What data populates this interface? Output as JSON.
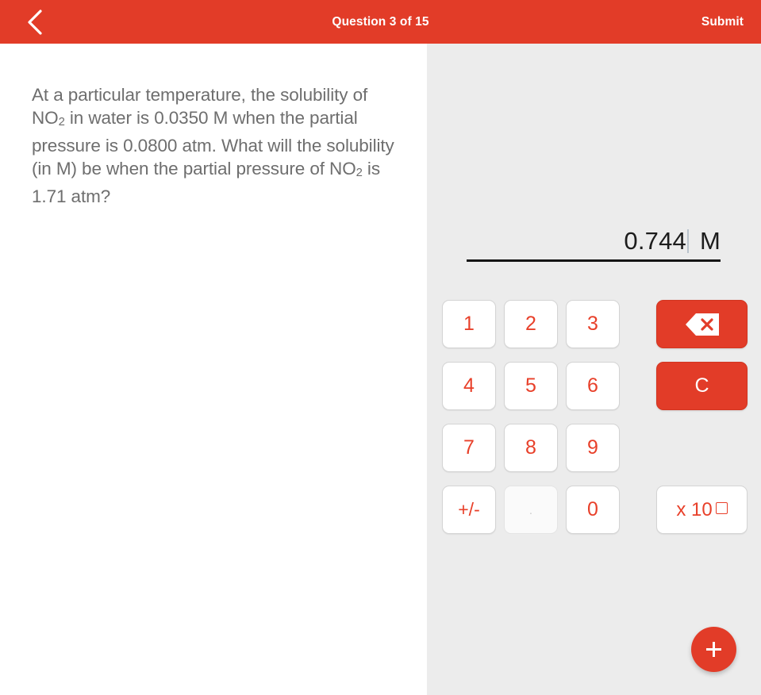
{
  "header": {
    "back_icon": "chevron-left-icon",
    "title": "Question 3 of 15",
    "submit_label": "Submit",
    "background_color": "#e23c28",
    "text_color": "#ffffff"
  },
  "question": {
    "text_parts": [
      "At a particular temperature, the solubility of NO",
      "2",
      " in water is 0.0350 M when the partial pressure is 0.0800 atm. What will the solubility (in M) be when the partial pressure of NO",
      "2",
      " is 1.71 atm?"
    ],
    "line1": "At a particular temperature, the solubility",
    "line2_a": "of NO",
    "line2_sub": "2",
    "line2_b": " in water is 0.0350 M when the",
    "line3": "partial pressure is 0.0800 atm. What will",
    "line4": "the solubility (in M) be when the partial",
    "line5_a": "pressure of NO",
    "line5_sub": "2",
    "line5_b": " is 1.71 atm?",
    "text_color": "#6e6e6e"
  },
  "answer": {
    "value": "0.744",
    "unit": "M",
    "caret_visible": true,
    "text_color": "#1c1c1c",
    "underline_color": "#151515"
  },
  "keypad": {
    "accent_color": "#e8402a",
    "keys": [
      {
        "label": "1",
        "name": "key-1",
        "enabled": true
      },
      {
        "label": "2",
        "name": "key-2",
        "enabled": true
      },
      {
        "label": "3",
        "name": "key-3",
        "enabled": true
      },
      {
        "label": "4",
        "name": "key-4",
        "enabled": true
      },
      {
        "label": "5",
        "name": "key-5",
        "enabled": true
      },
      {
        "label": "6",
        "name": "key-6",
        "enabled": true
      },
      {
        "label": "7",
        "name": "key-7",
        "enabled": true
      },
      {
        "label": "8",
        "name": "key-8",
        "enabled": true
      },
      {
        "label": "9",
        "name": "key-9",
        "enabled": true
      },
      {
        "label": "+/-",
        "name": "key-sign",
        "enabled": true
      },
      {
        "label": ".",
        "name": "key-decimal",
        "enabled": false
      },
      {
        "label": "0",
        "name": "key-0",
        "enabled": true
      }
    ],
    "backspace": {
      "icon": "backspace-icon",
      "label": ""
    },
    "clear": {
      "label": "C",
      "name": "key-clear"
    },
    "exponent": {
      "label": "x 10",
      "name": "key-exponent",
      "superscript": ""
    }
  },
  "fab": {
    "icon": "plus-icon",
    "label": "+",
    "background_color": "#e23c28"
  },
  "panels": {
    "left_background": "#ffffff",
    "right_background": "#ececec"
  }
}
